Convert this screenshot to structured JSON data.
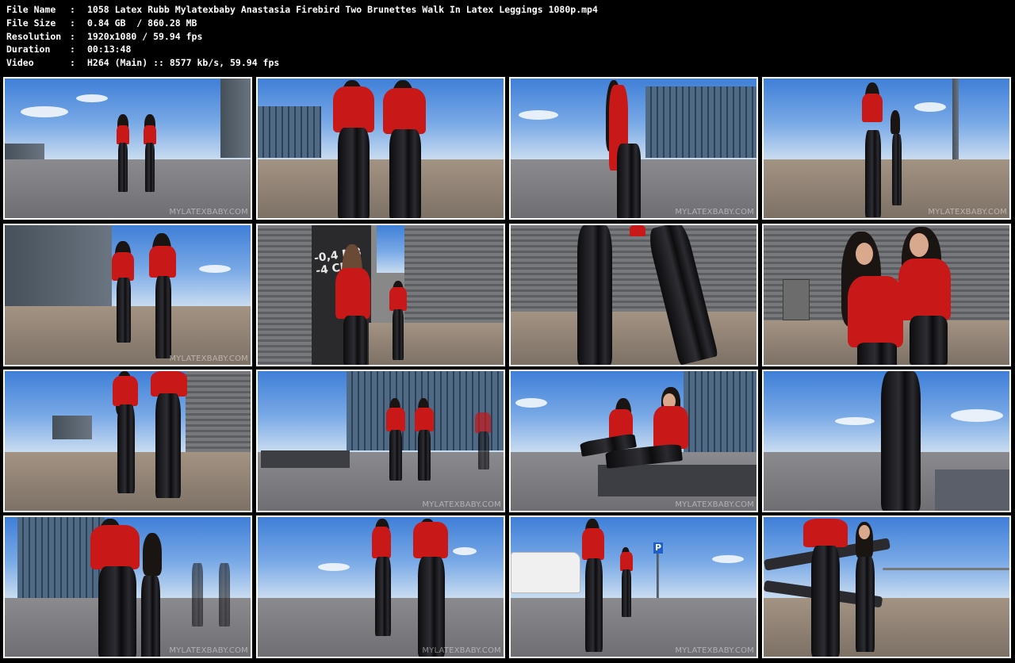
{
  "header": {
    "rows": [
      {
        "label": "File Name",
        "sep": ":",
        "value": "1058 Latex Rubb Mylatexbaby Anastasia Firebird Two Brunettes Walk In Latex Leggings 1080p.mp4"
      },
      {
        "label": "File Size",
        "sep": ":",
        "value": "0.84 GB  / 860.28 MB"
      },
      {
        "label": "Resolution",
        "sep": ":",
        "value": "1920x1080 / 59.94 fps"
      },
      {
        "label": "Duration",
        "sep": ":",
        "value": "00:13:48"
      },
      {
        "label": "Video",
        "sep": ":",
        "value": "H264 (Main) :: 8577 kb/s, 59.94 fps"
      }
    ]
  },
  "thumbnails": {
    "watermark": "MYLATEXBABY.COM",
    "wall_text": "-0,4 MB\n-4 CE",
    "parking_sign": "P",
    "items": [
      {
        "scene": "plaza-two-walking-toward"
      },
      {
        "scene": "plaza-two-walking-away-close"
      },
      {
        "scene": "glass-building-one-walking"
      },
      {
        "scene": "plaza-two-holding-hands"
      },
      {
        "scene": "road-two-walking-away"
      },
      {
        "scene": "metal-wall-alley"
      },
      {
        "scene": "legs-closeup-metal-wall"
      },
      {
        "scene": "two-posing-metal-wall"
      },
      {
        "scene": "metal-wall-walking-away"
      },
      {
        "scene": "glass-reflection-walking"
      },
      {
        "scene": "two-sitting-bench"
      },
      {
        "scene": "legs-closeup-planter"
      },
      {
        "scene": "glass-facade-closeup"
      },
      {
        "scene": "two-walking-low-angle"
      },
      {
        "scene": "van-parking-walking"
      },
      {
        "scene": "spiral-stairs"
      }
    ]
  }
}
